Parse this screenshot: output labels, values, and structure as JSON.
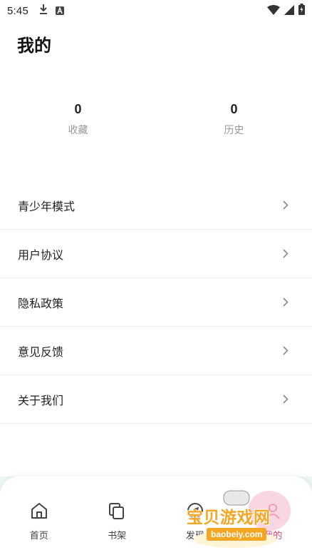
{
  "status_bar": {
    "time": "5:45"
  },
  "header": {
    "title": "我的"
  },
  "stats": [
    {
      "value": "0",
      "label": "收藏"
    },
    {
      "value": "0",
      "label": "历史"
    }
  ],
  "menu": [
    {
      "label": "青少年模式"
    },
    {
      "label": "用户协议"
    },
    {
      "label": "隐私政策"
    },
    {
      "label": "意见反馈"
    },
    {
      "label": "关于我们"
    }
  ],
  "tabbar": {
    "items": [
      {
        "label": "首页",
        "icon": "home-icon"
      },
      {
        "label": "书架",
        "icon": "bookshelf-icon"
      },
      {
        "label": "发现",
        "icon": "discover-icon"
      },
      {
        "label": "我的",
        "icon": "profile-icon"
      }
    ],
    "active_color": "#e2426b"
  },
  "watermark": {
    "text": "宝贝游戏网",
    "url": "baobeiy.com"
  }
}
